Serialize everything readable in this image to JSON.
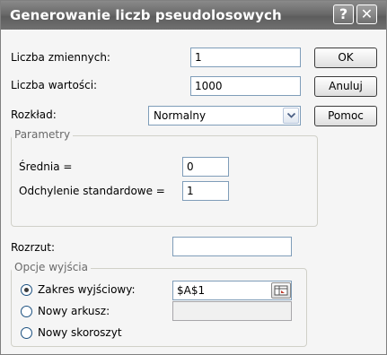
{
  "window": {
    "title": "Generowanie liczb pseudolosowych",
    "help_glyph": "?",
    "close_glyph": "✕"
  },
  "fields": {
    "num_variables_label": "Liczba zmiennych:",
    "num_variables_value": "1",
    "num_values_label": "Liczba wartości:",
    "num_values_value": "1000",
    "distribution_label": "Rozkład:",
    "distribution_value": "Normalny"
  },
  "buttons": {
    "ok": "OK",
    "cancel": "Anuluj",
    "help": "Pomoc"
  },
  "parameters": {
    "legend": "Parametry",
    "mean_label": "Średnia =",
    "mean_value": "0",
    "stddev_label": "Odchylenie standardowe =",
    "stddev_value": "1"
  },
  "seed": {
    "label": "Rozrzut:",
    "value": ""
  },
  "output": {
    "legend": "Opcje wyjścia",
    "options": [
      {
        "label": "Zakres wyjściowy:",
        "selected": true,
        "value": "$A$1"
      },
      {
        "label": "Nowy arkusz:",
        "selected": false,
        "value": ""
      },
      {
        "label": "Nowy skoroszyt",
        "selected": false
      }
    ]
  },
  "icons": {
    "help": "help-icon",
    "close": "close-icon",
    "dropdown": "chevron-down-icon",
    "range_ref": "collapse-dialog-icon"
  }
}
